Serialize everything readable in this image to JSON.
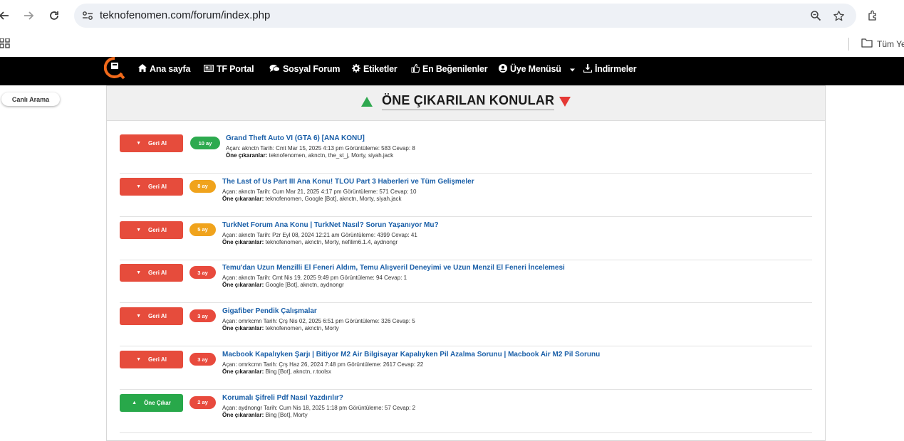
{
  "browser": {
    "url": "teknofenomen.com/forum/index.php",
    "bookmark_folder": "Tüm Ye"
  },
  "navbar": {
    "items": [
      {
        "label": "Ana sayfa",
        "icon": "home-icon"
      },
      {
        "label": "TF Portal",
        "icon": "newspaper-icon"
      },
      {
        "label": "Sosyal Forum",
        "icon": "comments-icon"
      },
      {
        "label": "Etiketler",
        "icon": "gear-icon"
      },
      {
        "label": "En Beğenilenler",
        "icon": "thumbs-up-icon"
      },
      {
        "label": "Üye Menüsü",
        "icon": "user-circle-icon"
      },
      {
        "label": "İndirmeler",
        "icon": "download-icon"
      }
    ]
  },
  "sidebar": {
    "live_search": "Canlı Arama"
  },
  "featured": {
    "title": "ÖNE ÇIKARILAN KONULAR",
    "featured_by_label": "Öne çıkaranlar:",
    "topics": [
      {
        "action": "Geri Al",
        "action_type": "red",
        "age": "10 ay",
        "age_color": "green",
        "title": "Grand Theft Auto VI (GTA 6) [ANA KONU]",
        "meta": "Açan: aknctn Tarih: Cmt Mar 15, 2025 4:13 pm Görüntüleme: 583 Cevap: 8",
        "featured_by": "teknofenomen, aknctn, the_st_j, Morty, siyah.jack"
      },
      {
        "action": "Geri Al",
        "action_type": "red",
        "age": "8 ay",
        "age_color": "orange",
        "title": "The Last of Us Part III Ana Konu! TLOU Part 3 Haberleri ve Tüm Gelişmeler",
        "meta": "Açan: aknctn Tarih: Cum Mar 21, 2025 4:17 pm Görüntüleme: 571 Cevap: 10",
        "featured_by": "teknofenomen, Google [Bot], aknctn, Morty, siyah.jack"
      },
      {
        "action": "Geri Al",
        "action_type": "red",
        "age": "5 ay",
        "age_color": "orange",
        "title": "TurkNet Forum Ana Konu | TurkNet Nasıl? Sorun Yaşanıyor Mu?",
        "meta": "Açan: aknctn Tarih: Pzr Eyl 08, 2024 12:21 am Görüntüleme: 4399 Cevap: 41",
        "featured_by": "teknofenomen, aknctn, Morty, nefilim6.1.4, aydnongr"
      },
      {
        "action": "Geri Al",
        "action_type": "red",
        "age": "3 ay",
        "age_color": "red",
        "title": "Temu'dan Uzun Menzilli El Feneri Aldım, Temu Alışveril Deneyimi ve Uzun Menzil El Feneri İncelemesi",
        "meta": "Açan: aknctn Tarih: Cmt Nis 19, 2025 9:49 pm Görüntüleme: 94 Cevap: 1",
        "featured_by": "Google [Bot], aknctn, aydnongr"
      },
      {
        "action": "Geri Al",
        "action_type": "red",
        "age": "3 ay",
        "age_color": "red",
        "title": "Gigafiber Pendik Çalışmalar",
        "meta": "Açan: omrkcmn Tarih: Çrş Nis 02, 2025 6:51 pm Görüntüleme: 326 Cevap: 5",
        "featured_by": "teknofenomen, aknctn, Morty"
      },
      {
        "action": "Geri Al",
        "action_type": "red",
        "age": "3 ay",
        "age_color": "red",
        "title": "Macbook Kapalıyken Şarjı | Bitiyor M2 Air Bilgisayar Kapalıyken Pil Azalma Sorunu | Macbook Air M2 Pil Sorunu",
        "meta": "Açan: omrkcmn Tarih: Çrş Haz 26, 2024 7:48 pm Görüntüleme: 2617 Cevap: 22",
        "featured_by": "Bing [Bot], aknctn, r.toolsx"
      },
      {
        "action": "Öne Çıkar",
        "action_type": "green",
        "age": "2 ay",
        "age_color": "red",
        "title": "Korumalı Şifreli Pdf Nasıl Yazdırılır?",
        "meta": "Açan: aydnongr Tarih: Cum Nis 18, 2025 1:18 pm Görüntüleme: 57 Cevap: 2",
        "featured_by": "Bing [Bot], Morty"
      }
    ]
  }
}
